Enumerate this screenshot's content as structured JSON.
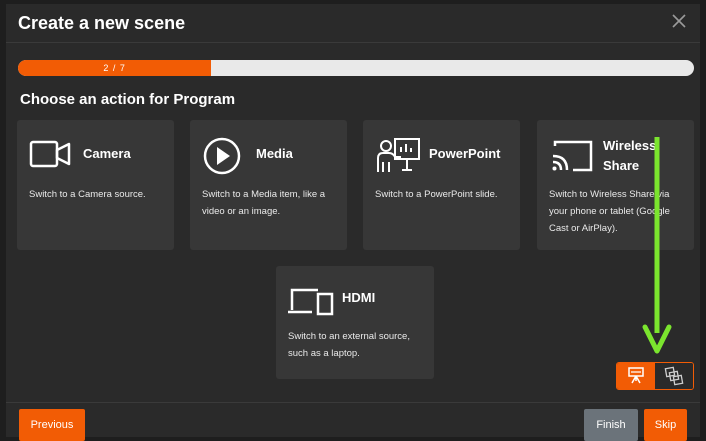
{
  "dialog": {
    "title": "Create a new scene",
    "close_icon": "close-icon"
  },
  "progress": {
    "label": "2 / 7",
    "current": 2,
    "total": 7,
    "fill_color": "#f25c05"
  },
  "prompt": "Choose an action for Program",
  "cards": [
    {
      "title": "Camera",
      "desc": "Switch to a Camera source.",
      "icon": "camera-icon"
    },
    {
      "title": "Media",
      "desc": "Switch to a Media item, like a video or an image.",
      "icon": "play-icon"
    },
    {
      "title": "PowerPoint",
      "desc": "Switch to a PowerPoint slide.",
      "icon": "presenter-icon"
    },
    {
      "title": "Wireless Share",
      "desc": "Switch to Wireless Share via your phone or tablet (Google Cast or AirPlay).",
      "icon": "cast-icon"
    },
    {
      "title": "HDMI",
      "desc": "Switch to an external source, such as a laptop.",
      "icon": "hdmi-icon"
    }
  ],
  "footer": {
    "previous": "Previous",
    "finish": "Finish",
    "skip": "Skip"
  },
  "colors": {
    "accent": "#f25c05",
    "arrow": "#7be52e",
    "card_bg": "#373737",
    "dialog_bg": "#2a2a2a"
  }
}
